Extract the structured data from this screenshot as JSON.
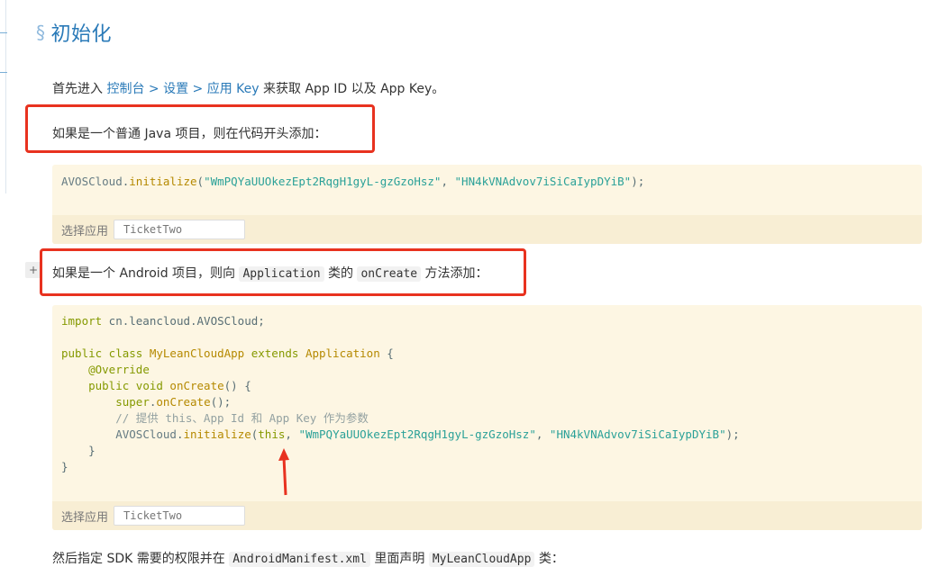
{
  "section": {
    "symbol": "§",
    "title": "初始化"
  },
  "intro": {
    "prefix": "首先进入 ",
    "link_console": "控制台",
    "sep1": " > ",
    "link_settings": "设置",
    "sep2": " > ",
    "link_appkey": "应用 Key",
    "suffix": " 来获取 App ID 以及 App Key。"
  },
  "java_note": "如果是一个普通 Java 项目，则在代码开头添加：",
  "java_code": {
    "obj": "AVOSCloud",
    "dot": ".",
    "method": "initialize",
    "open": "(",
    "arg1": "\"WmPQYaUUOkezEpt2RqgH1gyL-gzGzoHsz\"",
    "comma": ", ",
    "arg2": "\"HN4kVNAdvov7iSiCaIypDYiB\"",
    "close": ");"
  },
  "app_selector": {
    "label": "选择应用",
    "value": "TicketTwo"
  },
  "android_note": {
    "prefix": "如果是一个 Android 项目，则向 ",
    "code1": "Application",
    "mid": " 类的 ",
    "code2": "onCreate",
    "suffix": " 方法添加："
  },
  "android_code": {
    "import_kw": "import",
    "import_path": " cn.leancloud.AVOSCloud;",
    "l2_public": "public",
    "l2_class": " class ",
    "l2_name": "MyLeanCloudApp",
    "l2_extends": " extends ",
    "l2_parent": "Application",
    "l2_brace": " {",
    "l3_override": "@Override",
    "l4_public": "public",
    "l4_void": " void ",
    "l4_method": "onCreate",
    "l4_rest": "() {",
    "l5_super": "super",
    "l5_dot": ".",
    "l5_method": "onCreate",
    "l5_rest": "();",
    "l6_comment": "// 提供 this、App Id 和 App Key 作为参数",
    "l7_obj": "AVOSCloud",
    "l7_dot": ".",
    "l7_method": "initialize",
    "l7_open": "(",
    "l7_this": "this",
    "l7_c1": ", ",
    "l7_arg1": "\"WmPQYaUUOkezEpt2RqgH1gyL-gzGzoHsz\"",
    "l7_c2": ", ",
    "l7_arg2": "\"HN4kVNAdvov7iSiCaIypDYiB\"",
    "l7_close": ");",
    "l8": "}",
    "l9": "}"
  },
  "app_selector2": {
    "label": "选择应用",
    "value": "TicketTwo"
  },
  "plus_label": "+",
  "footer": {
    "prefix": "然后指定 SDK 需要的权限并在 ",
    "code1": "AndroidManifest.xml",
    "mid": " 里面声明 ",
    "code2": "MyLeanCloudApp",
    "suffix": " 类："
  },
  "colors": {
    "annotation_red": "#e8321f",
    "link": "#2a7ab8",
    "code_bg": "#fdf6e3"
  }
}
